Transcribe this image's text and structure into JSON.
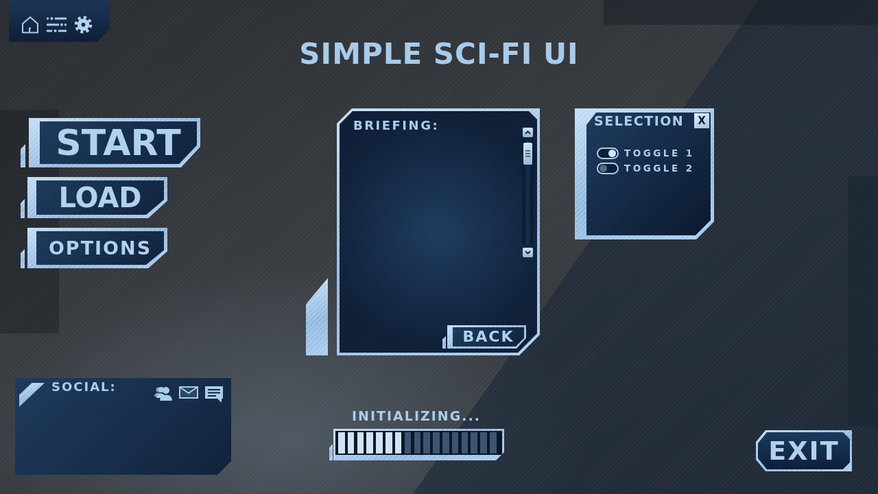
{
  "title": "SIMPLE SCI-FI UI",
  "main_menu": [
    "START",
    "LOAD",
    "OPTIONS"
  ],
  "briefing_panel": {
    "title": "BRIEFING:",
    "back_button": "BACK"
  },
  "selection_panel": {
    "title": "SELECTION",
    "close_button": "X",
    "toggles": [
      {
        "label": "TOGGLE 1",
        "on": true
      },
      {
        "label": "TOGGLE 2",
        "on": false
      }
    ]
  },
  "social_panel": {
    "title": "SOCIAL:"
  },
  "progress": {
    "label": "INITIALIZING...",
    "level": 0.41
  },
  "exit_button": "EXIT"
}
